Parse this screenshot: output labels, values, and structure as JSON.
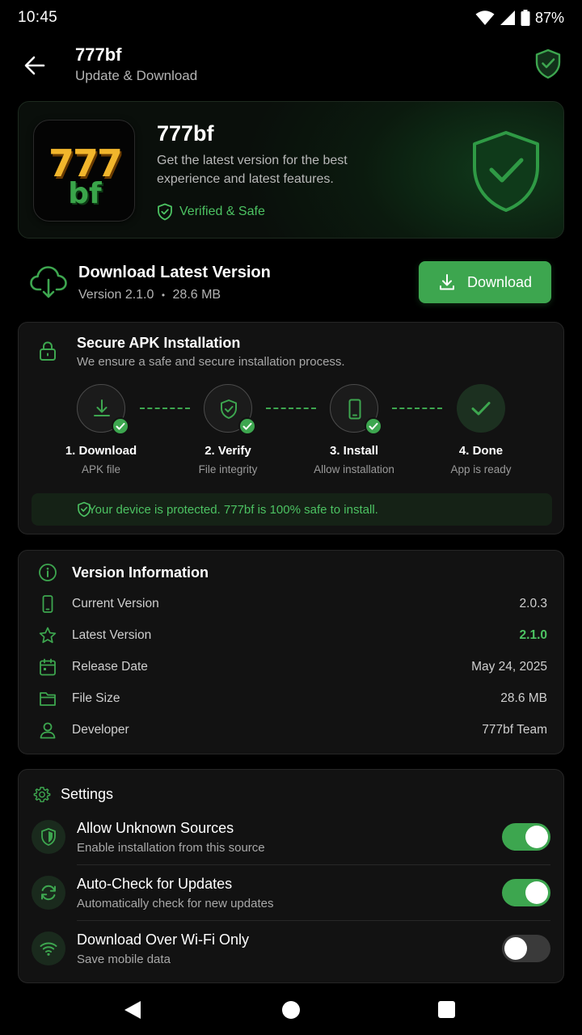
{
  "status_bar": {
    "time": "10:45",
    "battery": "87%"
  },
  "header": {
    "title": "777bf",
    "subtitle": "Update & Download"
  },
  "hero": {
    "logo_top": "777",
    "logo_bottom": "bf",
    "app_name": "777bf",
    "description": "Get the latest version for the best experience and latest features.",
    "verified_label": "Verified & Safe"
  },
  "download": {
    "title": "Download Latest Version",
    "version": "Version 2.1.0",
    "separator": "•",
    "size": "28.6 MB",
    "button_label": "Download"
  },
  "secure_install": {
    "title": "Secure APK Installation",
    "subtitle": "We ensure a safe and secure installation process.",
    "steps": [
      {
        "label": "1. Download",
        "sub": "APK file",
        "icon": "download-icon",
        "completed": true
      },
      {
        "label": "2. Verify",
        "sub": "File integrity",
        "icon": "shield-check-icon",
        "completed": true
      },
      {
        "label": "3. Install",
        "sub": "Allow installation",
        "icon": "phone-icon",
        "completed": true
      },
      {
        "label": "4. Done",
        "sub": "App is ready",
        "icon": "check-icon",
        "completed": true
      }
    ],
    "protected_message": "Your device is protected. 777bf is 100% safe to install."
  },
  "version_info": {
    "title": "Version Information",
    "rows": [
      {
        "label": "Current Version",
        "value": "2.0.3",
        "icon": "phone-icon"
      },
      {
        "label": "Latest Version",
        "value": "2.1.0",
        "icon": "star-icon"
      },
      {
        "label": "Release Date",
        "value": "May 24, 2025",
        "icon": "calendar-icon"
      },
      {
        "label": "File Size",
        "value": "28.6 MB",
        "icon": "folder-icon"
      },
      {
        "label": "Developer",
        "value": "777bf Team",
        "icon": "user-icon"
      }
    ]
  },
  "settings": {
    "title": "Settings",
    "items": [
      {
        "title": "Allow Unknown Sources",
        "subtitle": "Enable installation from this source",
        "enabled": true,
        "icon": "shield-half-icon"
      },
      {
        "title": "Auto-Check for Updates",
        "subtitle": "Automatically check for new updates",
        "enabled": true,
        "icon": "refresh-icon"
      },
      {
        "title": "Download Over Wi-Fi Only",
        "subtitle": "Save mobile data",
        "enabled": false,
        "icon": "wifi-icon"
      }
    ]
  },
  "colors": {
    "accent": "#3da64f",
    "accent_text": "#4cc262",
    "background": "#000000",
    "card": "#121212"
  }
}
